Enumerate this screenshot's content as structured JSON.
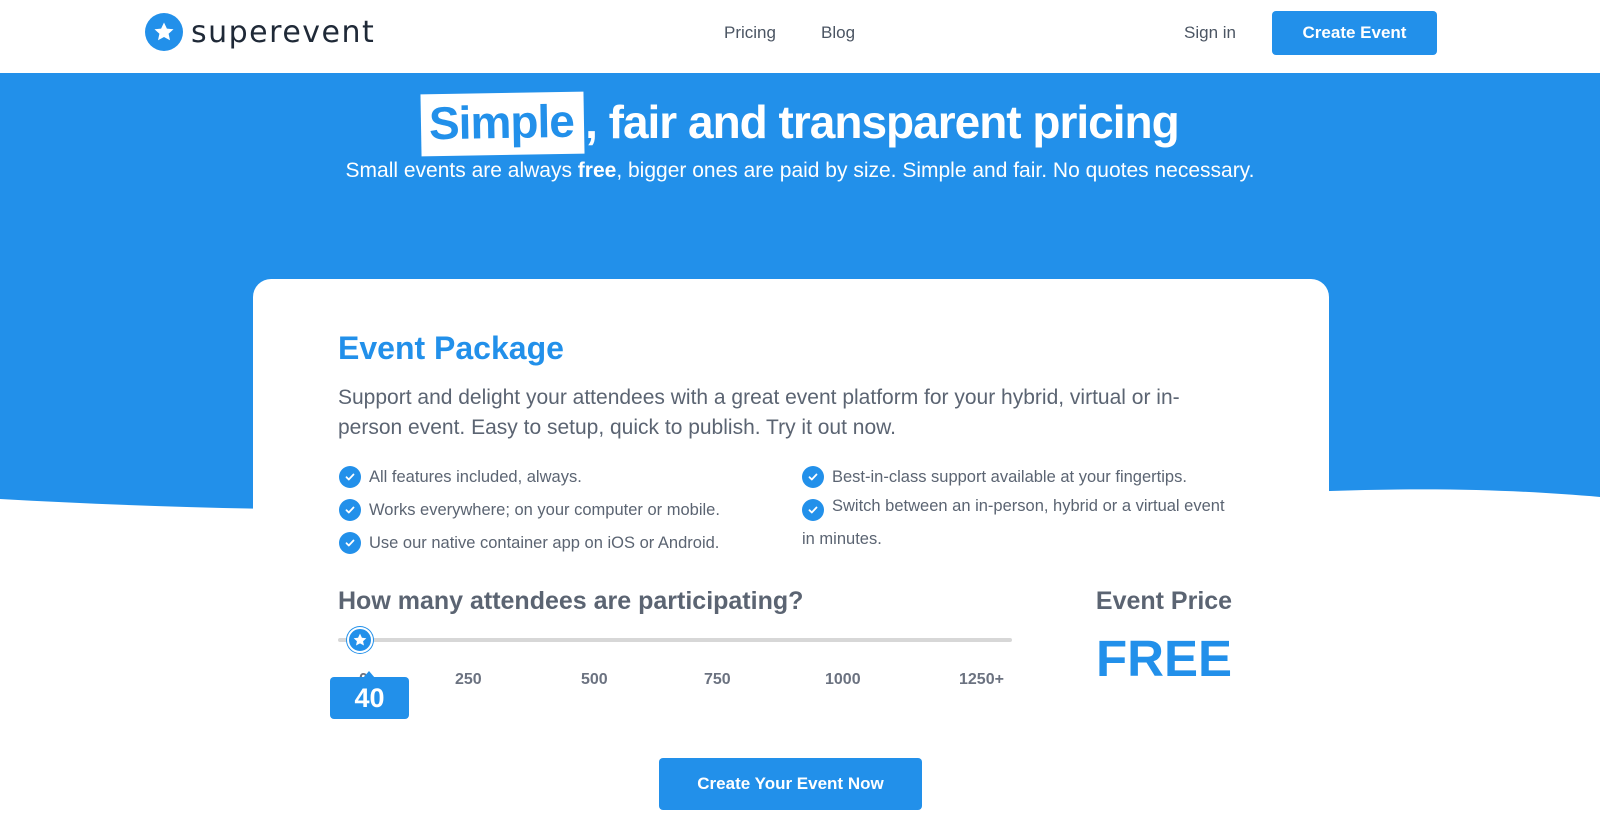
{
  "header": {
    "logo_text": "superevent",
    "nav": {
      "pricing": "Pricing",
      "blog": "Blog"
    },
    "sign_in": "Sign in",
    "create_event": "Create Event"
  },
  "hero": {
    "title_highlight": "Simple",
    "title_rest": ", fair and transparent pricing",
    "subtitle_pre": "Small events are always ",
    "subtitle_bold": "free",
    "subtitle_post": ", bigger ones are paid by size. Simple and fair. No quotes necessary."
  },
  "package": {
    "title": "Event Package",
    "description": "Support and delight your attendees with a great event platform for your hybrid, virtual or in-person event. Easy to setup, quick to publish. Try it out now.",
    "features": [
      "All features included, always.",
      "Works everywhere; on your computer or mobile.",
      "Use our native container app on iOS or Android.",
      "Best-in-class support available at your fingertips.",
      "Switch between an in-person, hybrid or a virtual event in minutes."
    ]
  },
  "attendees": {
    "question": "How many attendees are participating?",
    "value": "40",
    "slider_fraction": 0.032,
    "ticks": [
      "0",
      "250",
      "500",
      "750",
      "1000",
      "1250+"
    ]
  },
  "price": {
    "label": "Event Price",
    "value": "FREE"
  },
  "cta": {
    "label": "Create Your Event Now"
  },
  "colors": {
    "accent": "#2290ea",
    "text": "#5b6472",
    "track": "#d7d7d7"
  },
  "icons": {
    "logo": "star-icon",
    "check": "check-icon",
    "thumb": "star-icon"
  }
}
